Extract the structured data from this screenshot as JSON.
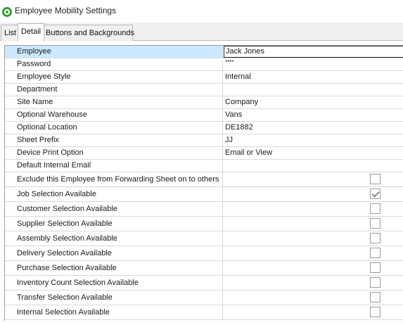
{
  "window": {
    "title": "Employee Mobility Settings",
    "icon": "app-logo-icon"
  },
  "tabs": [
    {
      "label": "List",
      "active": false
    },
    {
      "label": "Detail",
      "active": true
    },
    {
      "label": "Buttons and Backgrounds",
      "active": false
    }
  ],
  "fields": [
    {
      "label": "Employee",
      "value": "Jack Jones",
      "selected": true
    },
    {
      "label": "Password",
      "value": "****"
    },
    {
      "label": "Employee Style",
      "value": "Internal"
    },
    {
      "label": "Department",
      "value": ""
    },
    {
      "label": "Site Name",
      "value": "Company"
    },
    {
      "label": "Optional Warehouse",
      "value": "Vans"
    },
    {
      "label": "Optional Location",
      "value": "DE1882"
    },
    {
      "label": "Sheet Prefix",
      "value": "JJ"
    },
    {
      "label": "Device Print Option",
      "value": "Email or View"
    },
    {
      "label": "Default Internal Email",
      "value": ""
    }
  ],
  "options": [
    {
      "label": "Exclude this Employee from Forwarding Sheet on to others",
      "checked": false
    },
    {
      "label": "Job Selection Available",
      "checked": true
    },
    {
      "label": "Customer Selection Available",
      "checked": false
    },
    {
      "label": "Supplier Selection Available",
      "checked": false
    },
    {
      "label": "Assembly Selection Available",
      "checked": false
    },
    {
      "label": "Delivery Selection Available",
      "checked": false
    },
    {
      "label": "Purchase Selection Available",
      "checked": false
    },
    {
      "label": "Inventory Count Selection Available",
      "checked": false
    },
    {
      "label": "Transfer Selection Available",
      "checked": false
    },
    {
      "label": "Internal Selection Available",
      "checked": false
    }
  ]
}
